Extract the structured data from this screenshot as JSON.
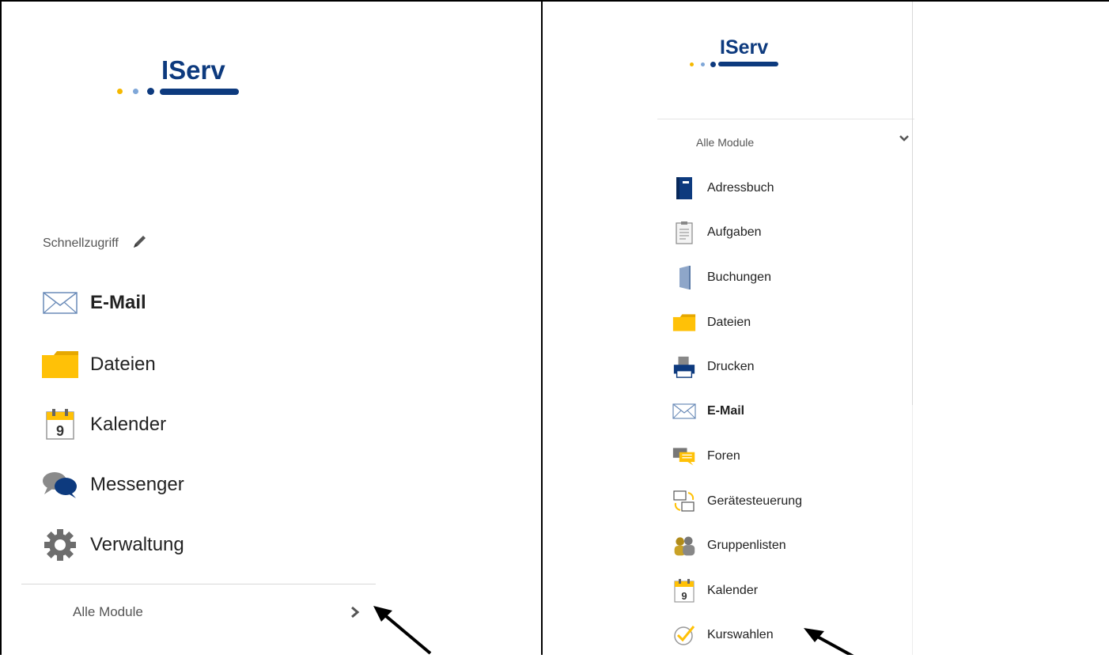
{
  "left": {
    "logo_text": "IServ",
    "quick_access_label": "Schnellzugriff",
    "items": [
      {
        "label": "E-Mail",
        "icon": "envelope-icon",
        "bold": true
      },
      {
        "label": "Dateien",
        "icon": "folder-icon",
        "bold": false
      },
      {
        "label": "Kalender",
        "icon": "calendar-icon",
        "bold": false
      },
      {
        "label": "Messenger",
        "icon": "chat-bubbles-icon",
        "bold": false
      },
      {
        "label": "Verwaltung",
        "icon": "gear-icon",
        "bold": false
      }
    ],
    "all_modules_label": "Alle Module",
    "calendar_day": "9"
  },
  "right": {
    "logo_text": "IServ",
    "all_modules_label": "Alle Module",
    "calendar_day": "9",
    "items": [
      {
        "label": "Adressbuch",
        "icon": "address-book-icon",
        "bold": false
      },
      {
        "label": "Aufgaben",
        "icon": "clipboard-icon",
        "bold": false
      },
      {
        "label": "Buchungen",
        "icon": "door-icon",
        "bold": false
      },
      {
        "label": "Dateien",
        "icon": "folder-icon",
        "bold": false
      },
      {
        "label": "Drucken",
        "icon": "printer-icon",
        "bold": false
      },
      {
        "label": "E-Mail",
        "icon": "envelope-icon",
        "bold": true
      },
      {
        "label": "Foren",
        "icon": "forum-bubbles-icon",
        "bold": false
      },
      {
        "label": "Gerätesteuerung",
        "icon": "device-control-icon",
        "bold": false
      },
      {
        "label": "Gruppenlisten",
        "icon": "group-users-icon",
        "bold": false
      },
      {
        "label": "Kalender",
        "icon": "calendar-icon",
        "bold": false
      },
      {
        "label": "Kurswahlen",
        "icon": "check-circle-icon",
        "bold": false
      }
    ]
  },
  "colors": {
    "brand_blue": "#0d3a7e",
    "accent_yellow": "#f5b800",
    "dot_light_blue": "#7fa7d8",
    "folder_yellow": "#ffc107",
    "gray_icon": "#6d6d6d"
  }
}
